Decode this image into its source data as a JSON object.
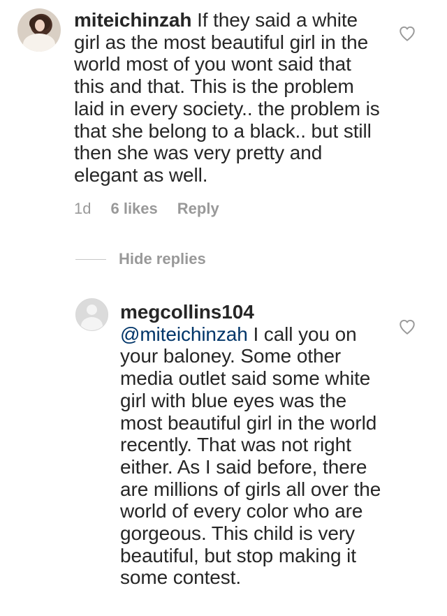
{
  "comment": {
    "username": "miteichinzah",
    "text": " If they said a white girl as the most beautiful girl in the world most of you wont said that this and that. This is the problem laid in every society.. the problem is that she belong to a black.. but still then she was very pretty and elegant as well.",
    "time": "1d",
    "likes": "6 likes",
    "reply_label": "Reply"
  },
  "replies_toggle": {
    "label": "Hide replies"
  },
  "reply": {
    "username": "megcollins104",
    "mention": "@miteichinzah",
    "text": " I call you on your baloney. Some other media outlet said some white girl with blue eyes was the most beautiful girl in the world recently. That was not right either. As I said before, there are millions of girls all over the world of every color who are gorgeous. This child is very beautiful, but stop making it some contest."
  },
  "icons": {
    "like": "heart-icon",
    "avatar_default": "default-avatar-icon",
    "avatar_photo": "user-photo-avatar"
  },
  "colors": {
    "text": "#262626",
    "meta": "#999999",
    "mention": "#003569",
    "divider": "#c7c7c7"
  }
}
